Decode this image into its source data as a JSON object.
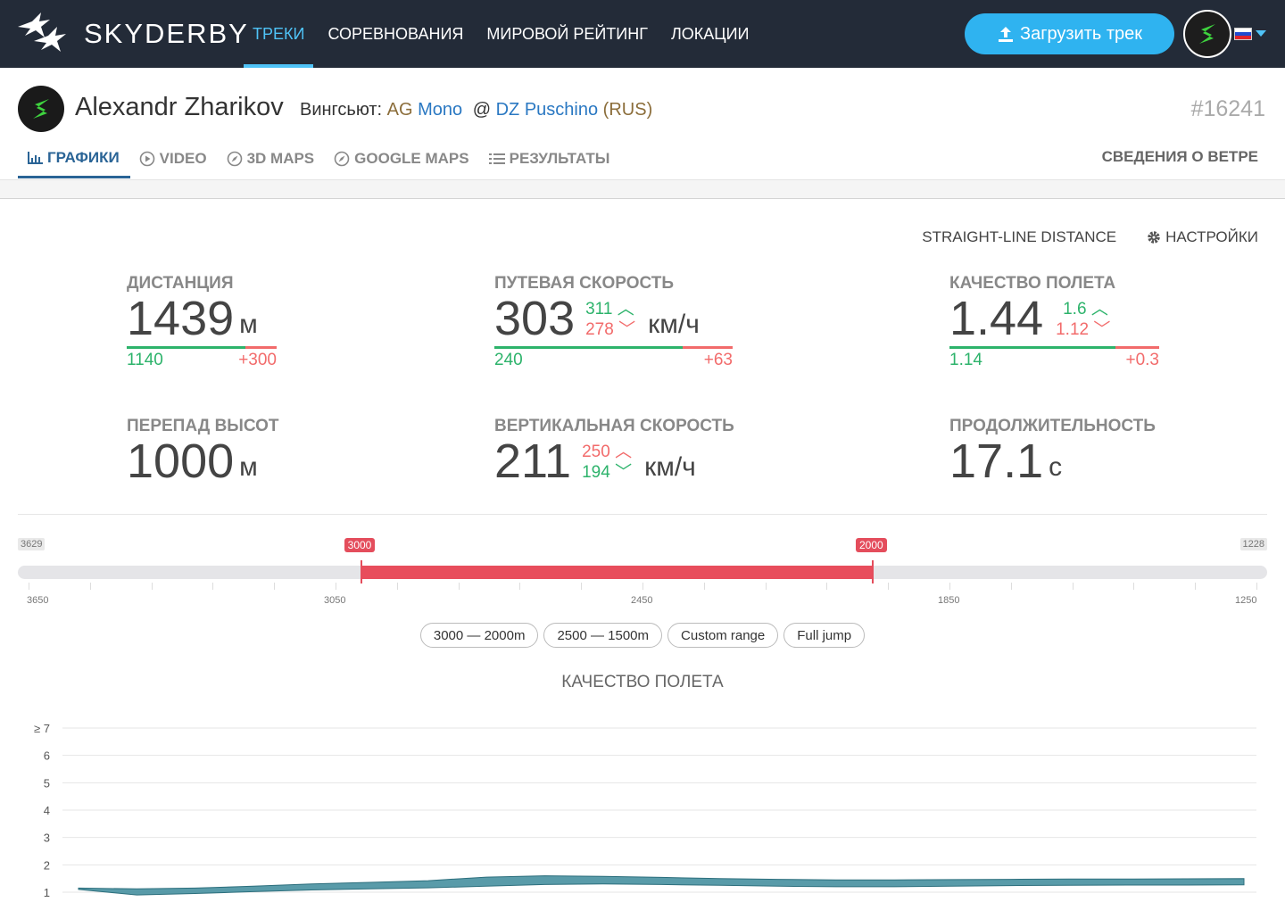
{
  "brand": "SKYDERBY",
  "nav": [
    {
      "label": "ТРЕКИ",
      "active": true
    },
    {
      "label": "СОРЕВНОВАНИЯ",
      "active": false
    },
    {
      "label": "МИРОВОЙ РЕЙТИНГ",
      "active": false
    },
    {
      "label": "ЛОКАЦИИ",
      "active": false
    }
  ],
  "upload_label": "Загрузить трек",
  "pilot": {
    "name": "Alexandr Zharikov",
    "suit_prefix": "Вингсьют:",
    "suit_brand": "AG",
    "suit_model": "Mono",
    "at": "@",
    "place": "DZ Puschino",
    "country_open": "(",
    "country": "RUS",
    "country_close": ")",
    "track_id": "#16241"
  },
  "tabs": [
    {
      "label": "ГРАФИКИ",
      "icon": "bar-chart-icon",
      "active": true
    },
    {
      "label": "VIDEO",
      "icon": "play-circle-icon",
      "active": false
    },
    {
      "label": "3D MAPS",
      "icon": "compass-icon",
      "active": false
    },
    {
      "label": "GOOGLE MAPS",
      "icon": "compass-icon",
      "active": false
    },
    {
      "label": "РЕЗУЛЬТАТЫ",
      "icon": "list-icon",
      "active": false
    }
  ],
  "wind_link": "СВЕДЕНИЯ О ВЕТРЕ",
  "straight_line": "STRAIGHT-LINE DISTANCE",
  "settings": "НАСТРОЙКИ",
  "stats": {
    "distance": {
      "label": "ДИСТАНЦИЯ",
      "value": "1439",
      "unit": "м",
      "low": "1140",
      "high": "+300",
      "fill": 0.79
    },
    "ground_speed": {
      "label": "ПУТЕВАЯ СКОРОСТЬ",
      "value": "303",
      "max": "311",
      "min": "278",
      "unit": "км/ч",
      "low": "240",
      "high": "+63",
      "fill": 0.79
    },
    "glide": {
      "label": "КАЧЕСТВО ПОЛЕТА",
      "value": "1.44",
      "max": "1.6",
      "min": "1.12",
      "unit": "",
      "low": "1.14",
      "high": "+0.3",
      "fill": 0.79
    },
    "elevation": {
      "label": "ПЕРЕПАД ВЫСОТ",
      "value": "1000",
      "unit": "м"
    },
    "vertical_speed": {
      "label": "ВЕРТИКАЛЬНАЯ СКОРОСТЬ",
      "value": "211",
      "max": "250",
      "min": "194",
      "unit": "км/ч"
    },
    "duration": {
      "label": "ПРОДОЛЖИТЕЛЬНОСТЬ",
      "value": "17.1",
      "unit": "с"
    }
  },
  "range": {
    "start_label": "3629",
    "end_label": "1228",
    "from": "3000",
    "to": "2000",
    "from_value": 3000,
    "to_value": 2000,
    "axis_max": 3650,
    "axis_min": 1250,
    "ticks": [
      "3650",
      "3050",
      "2450",
      "1850",
      "1250"
    ]
  },
  "presets": [
    "3000 — 2000m",
    "2500 — 1500m",
    "Custom range",
    "Full jump"
  ],
  "colors": {
    "nav_bg": "#232b38",
    "accent": "#2fb3f0",
    "range": "#e84d5c",
    "good": "#2db36b",
    "bad": "#f26b6b",
    "chart": "#3c8a9a"
  },
  "chart_data": {
    "type": "area",
    "title": "КАЧЕСТВО ПОЛЕТА",
    "ylabels": [
      "≥ 7",
      "6",
      "5",
      "4",
      "3",
      "2",
      "1"
    ],
    "ylim": [
      1,
      7
    ],
    "x": [
      3000,
      2950,
      2900,
      2850,
      2800,
      2750,
      2700,
      2650,
      2600,
      2550,
      2500,
      2450,
      2400,
      2350,
      2300,
      2250,
      2200,
      2150,
      2100,
      2050,
      2000
    ],
    "upper": [
      1.15,
      1.12,
      1.15,
      1.22,
      1.3,
      1.36,
      1.42,
      1.55,
      1.6,
      1.58,
      1.54,
      1.5,
      1.47,
      1.45,
      1.45,
      1.46,
      1.47,
      1.48,
      1.48,
      1.49,
      1.5
    ],
    "lower": [
      1.1,
      0.9,
      0.95,
      1.02,
      1.08,
      1.12,
      1.16,
      1.22,
      1.28,
      1.3,
      1.28,
      1.25,
      1.22,
      1.2,
      1.2,
      1.22,
      1.24,
      1.25,
      1.26,
      1.26,
      1.27
    ]
  }
}
